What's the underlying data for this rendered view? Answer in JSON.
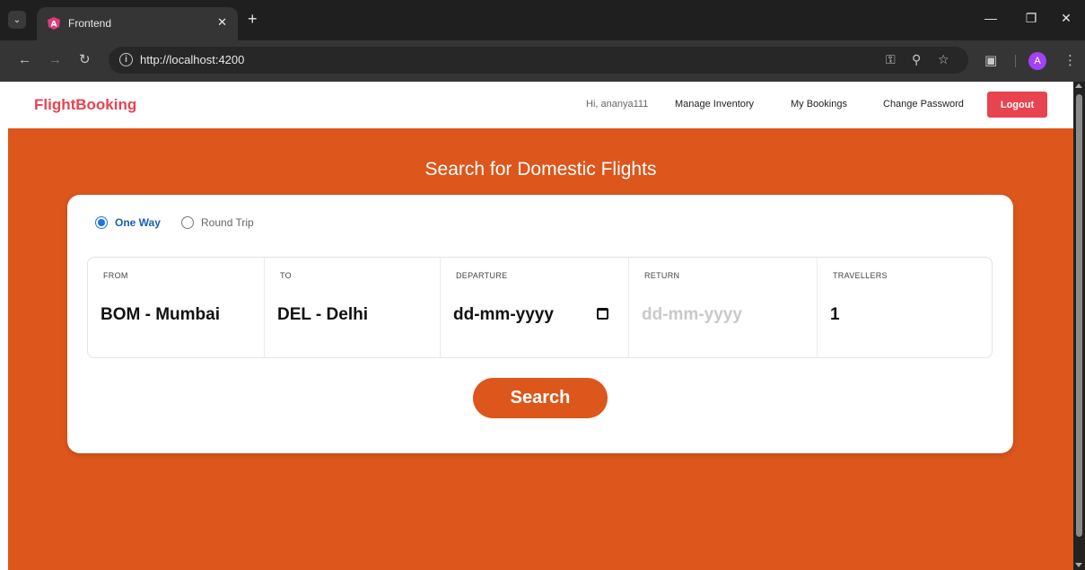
{
  "browser": {
    "tab_title": "Frontend",
    "url": "http://localhost:4200",
    "avatar_initial": "A",
    "icons": [
      "tab-search-icon",
      "favicon-icon",
      "tab-close-icon",
      "new-tab-icon",
      "minimize-icon",
      "restore-icon",
      "window-close-icon",
      "back-icon",
      "forward-icon",
      "reload-icon",
      "site-info-icon",
      "password-key-icon",
      "zoom-icon",
      "bookmark-star-icon",
      "extensions-icon",
      "menu-icon"
    ]
  },
  "header": {
    "brand": "FlightBooking",
    "greeting": "Hi, ananya111",
    "nav": {
      "manage_inventory": "Manage Inventory",
      "my_bookings": "My Bookings",
      "change_password": "Change Password"
    },
    "logout_label": "Logout"
  },
  "hero": {
    "title": "Search for Domestic Flights"
  },
  "search": {
    "trip_types": {
      "one_way": "One Way",
      "round_trip": "Round Trip"
    },
    "selected_trip_type": "One Way",
    "fields": {
      "from": {
        "label": "FROM",
        "value": "BOM - Mumbai"
      },
      "to": {
        "label": "TO",
        "value": "DEL - Delhi"
      },
      "departure": {
        "label": "DEPARTURE",
        "value": "dd-mm-yyyy"
      },
      "return": {
        "label": "RETURN",
        "value": "dd-mm-yyyy"
      },
      "travellers": {
        "label": "TRAVELLERS",
        "value": "1"
      }
    },
    "button_label": "Search"
  },
  "colors": {
    "brand_red": "#e8434f",
    "hero_orange": "#dd561b",
    "radio_blue": "#1a73e8"
  }
}
